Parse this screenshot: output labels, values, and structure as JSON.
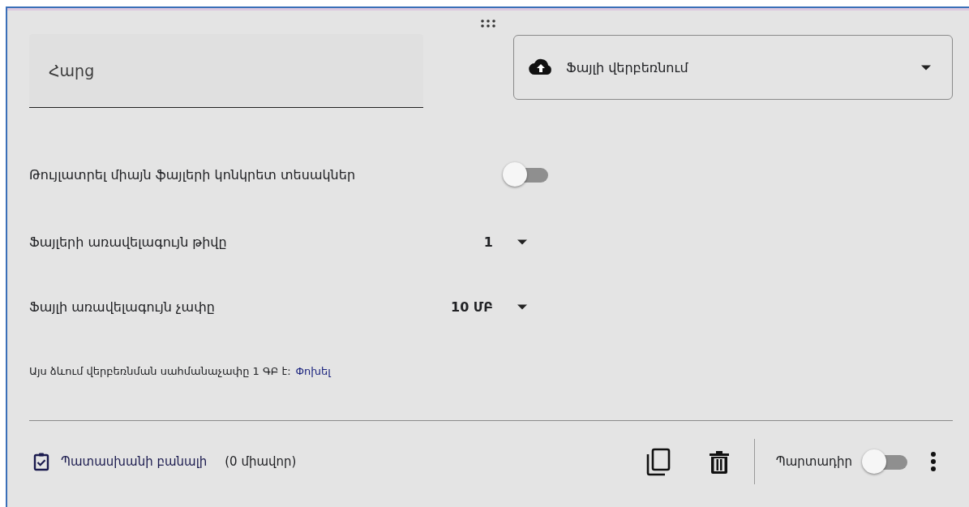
{
  "question": {
    "placeholder": "Հարց"
  },
  "type_dropdown": {
    "label": "Ֆայլի վերբեռնում"
  },
  "allow_types": {
    "label": "Թույլատրել միայն ֆայլերի կոնկրետ տեսակներ",
    "on": false
  },
  "settings": [
    {
      "label": "Ֆայլերի առավելագույն թիվը",
      "value": "1"
    },
    {
      "label": "Ֆայլի առավելագույն չափը",
      "value": "10 ՄԲ"
    }
  ],
  "note": {
    "text": "Այս ձևում վերբեռնման սահմանաչափը 1 ԳԲ է:",
    "link": "Փոխել"
  },
  "footer": {
    "answer_key": "Պատասխանի բանալի",
    "points": "(0 միավոր)",
    "required_label": "Պարտադիր",
    "required": false
  }
}
